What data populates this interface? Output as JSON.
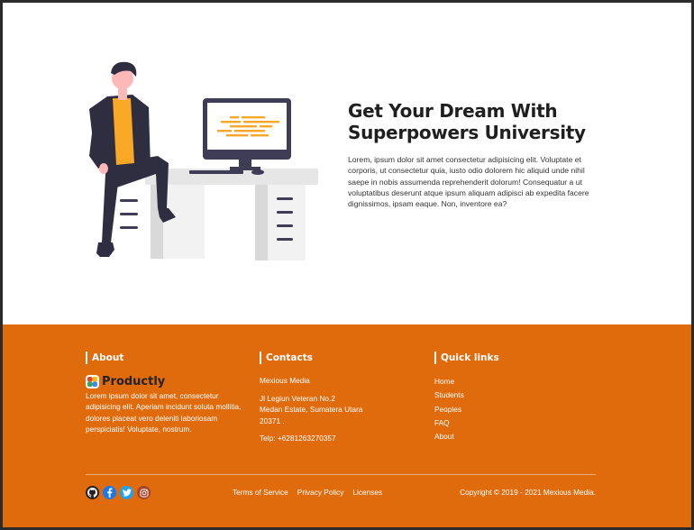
{
  "hero": {
    "title_line1": "Get Your Dream With",
    "title_line2": "Superpowers University",
    "body": "Lorem, ipsum dolor sit amet consectetur adipisicing elit. Voluptate et corporis, ut consectetur quia, iusto odio dolorem hic aliquid unde nihil saepe in nobis assumenda reprehenderit dolorum! Consequatur a ut voluptatibus deserunt atque ipsum aliquam adipisci ab expedita facere dignissimos, ipsam eaque. Non, inventore ea?"
  },
  "footer": {
    "about": {
      "title": "About",
      "brand": "Productly",
      "text": "Lorem ipsum dolor sit amet, consectetur adipisicing elit. Aperiam incidunt soluta mollitia, dolores placeat vero deleniti laboriosam perspiciatis! Voluptate, nostrum."
    },
    "contacts": {
      "title": "Contacts",
      "company": "Mexious Media",
      "address_line1": "Jl Legiun Veteran No.2",
      "address_line2": "Medan Estate, Sumatera Utara",
      "address_line3": "20371 .",
      "phone": "Telp: +6281263270357"
    },
    "quick_links": {
      "title": "Quick links",
      "items": [
        "Home",
        "Students",
        "Peoples",
        "FAQ",
        "About"
      ]
    },
    "socials": [
      {
        "icon": "github-icon",
        "color": "#222222"
      },
      {
        "icon": "facebook-icon",
        "color": "#1877f2"
      },
      {
        "icon": "twitter-icon",
        "color": "#1da1f2"
      },
      {
        "icon": "instagram-icon",
        "color": "#a4452a"
      }
    ],
    "legal": {
      "terms": "Terms of Service",
      "privacy": "Privacy Policy",
      "licenses": "Licenses"
    },
    "copyright": "Copyright © 2019 - 2021 Mexious Media."
  },
  "colors": {
    "footer_bg": "#e06b0d",
    "accent_orange": "#f9a826",
    "dark_purple": "#3f3d56"
  }
}
